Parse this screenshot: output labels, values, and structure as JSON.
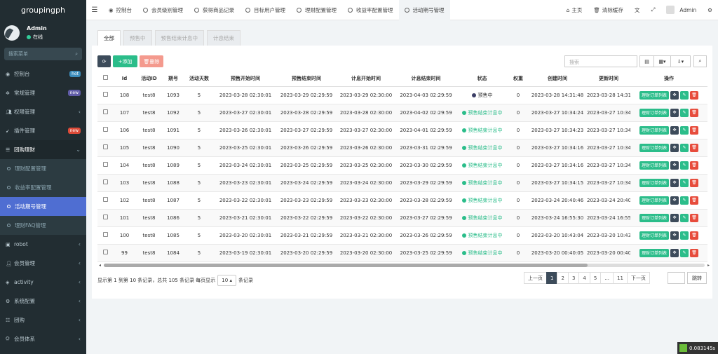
{
  "app": {
    "logo": "groupingph",
    "user": "Admin",
    "status": "在线",
    "search_placeholder": "搜索菜单"
  },
  "menu": [
    {
      "icon": "dashboard-icon",
      "label": "控制台",
      "badge": "hot",
      "badge_color": "#3c8dbc"
    },
    {
      "icon": "cogs-icon",
      "label": "常规管理",
      "badge": "new",
      "badge_color": "#605ca8"
    },
    {
      "icon": "users-icon",
      "label": "权限管理",
      "chev": "‹"
    },
    {
      "icon": "rocket-icon",
      "label": "插件管理",
      "badge": "new",
      "badge_color": "#dd4b39"
    },
    {
      "icon": "list-icon",
      "label": "团购理财",
      "chev": "⌄",
      "open": true
    }
  ],
  "submenu": [
    "理财配置管理",
    "收益率配置管理",
    "活动期号管理",
    "理财FAQ管理"
  ],
  "menu2": [
    "robot",
    "会员管理",
    "activity",
    "系统配置",
    "团购",
    "会员体系"
  ],
  "topbar": {
    "tabs": [
      "控制台",
      "会员级别管理",
      "获得商品记录",
      "目标用户管理",
      "理财配置管理",
      "收益率配置管理",
      "活动期号管理"
    ],
    "home": "主页",
    "clear": "清除缓存",
    "admin": "Admin"
  },
  "page_tabs": [
    "全部",
    "预售中",
    "预售结束计息中",
    "计息结束"
  ],
  "toolbar": {
    "add": "添加",
    "delete": "删除",
    "search_placeholder": "搜索"
  },
  "columns": [
    "Id",
    "活动ID",
    "期号",
    "活动天数",
    "预售开始时间",
    "预售结束时间",
    "计息开始时间",
    "计息结束时间",
    "状态",
    "权重",
    "创建时间",
    "更新时间",
    "操作"
  ],
  "rows": [
    [
      "108",
      "test8",
      "1093",
      "5",
      "2023-03-28 02:30:01",
      "2023-03-29 02:29:59",
      "2023-03-29 02:30:00",
      "2023-04-03 02:29:59",
      "预售中",
      "0",
      "2023-03-28 14:31:48",
      "2023-03-28 14:31:"
    ],
    [
      "107",
      "test8",
      "1092",
      "5",
      "2023-03-27 02:30:01",
      "2023-03-28 02:29:59",
      "2023-03-28 02:30:00",
      "2023-04-02 02:29:59",
      "预售结束计息中",
      "0",
      "2023-03-27 10:34:24",
      "2023-03-27 10:34:"
    ],
    [
      "106",
      "test8",
      "1091",
      "5",
      "2023-03-26 02:30:01",
      "2023-03-27 02:29:59",
      "2023-03-27 02:30:00",
      "2023-04-01 02:29:59",
      "预售结束计息中",
      "0",
      "2023-03-27 10:34:23",
      "2023-03-27 10:34:"
    ],
    [
      "105",
      "test8",
      "1090",
      "5",
      "2023-03-25 02:30:01",
      "2023-03-26 02:29:59",
      "2023-03-26 02:30:00",
      "2023-03-31 02:29:59",
      "预售结束计息中",
      "0",
      "2023-03-27 10:34:16",
      "2023-03-27 10:34:"
    ],
    [
      "104",
      "test8",
      "1089",
      "5",
      "2023-03-24 02:30:01",
      "2023-03-25 02:29:59",
      "2023-03-25 02:30:00",
      "2023-03-30 02:29:59",
      "预售结束计息中",
      "0",
      "2023-03-27 10:34:16",
      "2023-03-27 10:34:"
    ],
    [
      "103",
      "test8",
      "1088",
      "5",
      "2023-03-23 02:30:01",
      "2023-03-24 02:29:59",
      "2023-03-24 02:30:00",
      "2023-03-29 02:29:59",
      "预售结束计息中",
      "0",
      "2023-03-27 10:34:15",
      "2023-03-27 10:34:"
    ],
    [
      "102",
      "test8",
      "1087",
      "5",
      "2023-03-22 02:30:01",
      "2023-03-23 02:29:59",
      "2023-03-23 02:30:00",
      "2023-03-28 02:29:59",
      "预售结束计息中",
      "0",
      "2023-03-24 20:40:46",
      "2023-03-24 20:40:"
    ],
    [
      "101",
      "test8",
      "1086",
      "5",
      "2023-03-21 02:30:01",
      "2023-03-22 02:29:59",
      "2023-03-22 02:30:00",
      "2023-03-27 02:29:59",
      "预售结束计息中",
      "0",
      "2023-03-24 16:55:30",
      "2023-03-24 16:55:"
    ],
    [
      "100",
      "test8",
      "1085",
      "5",
      "2023-03-20 02:30:01",
      "2023-03-21 02:29:59",
      "2023-03-21 02:30:00",
      "2023-03-26 02:29:59",
      "预售结束计息中",
      "0",
      "2023-03-20 10:43:04",
      "2023-03-20 10:43:"
    ],
    [
      "99",
      "test8",
      "1084",
      "5",
      "2023-03-19 02:30:01",
      "2023-03-20 02:29:59",
      "2023-03-20 02:30:00",
      "2023-03-25 02:29:59",
      "预售结束计息中",
      "0",
      "2023-03-20 00:40:05",
      "2023-03-20 00:40:"
    ]
  ],
  "row_action": "理财订单列表",
  "pagination": {
    "info": "显示第 1 到第 10 条记录，总共 105 条记录 每页显示",
    "page_size": "10",
    "suffix": "条记录",
    "prev": "上一页",
    "next": "下一页",
    "pages": [
      "1",
      "2",
      "3",
      "4",
      "5",
      "...",
      "11"
    ],
    "jump": "跳转"
  },
  "timer": "0.083145s"
}
